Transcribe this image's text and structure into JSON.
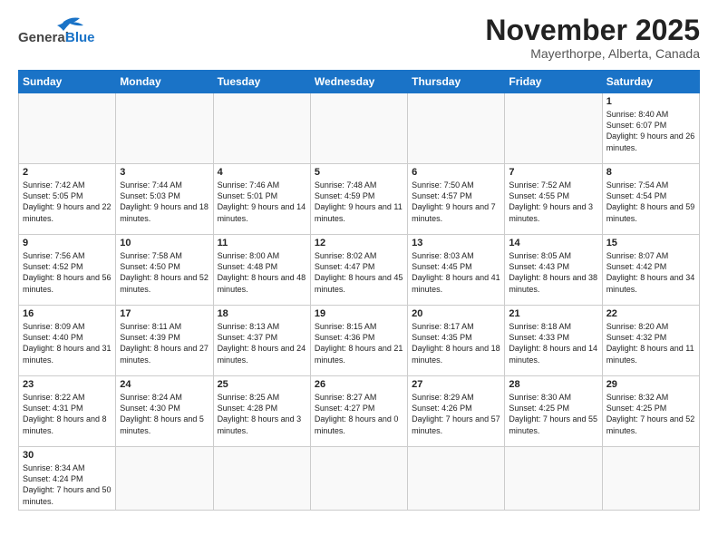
{
  "header": {
    "logo_general": "General",
    "logo_blue": "Blue",
    "month_title": "November 2025",
    "location": "Mayerthorpe, Alberta, Canada"
  },
  "days_of_week": [
    "Sunday",
    "Monday",
    "Tuesday",
    "Wednesday",
    "Thursday",
    "Friday",
    "Saturday"
  ],
  "weeks": [
    [
      {
        "day": "",
        "content": ""
      },
      {
        "day": "",
        "content": ""
      },
      {
        "day": "",
        "content": ""
      },
      {
        "day": "",
        "content": ""
      },
      {
        "day": "",
        "content": ""
      },
      {
        "day": "",
        "content": ""
      },
      {
        "day": "1",
        "content": "Sunrise: 8:40 AM\nSunset: 6:07 PM\nDaylight: 9 hours\nand 26 minutes."
      }
    ],
    [
      {
        "day": "2",
        "content": "Sunrise: 7:42 AM\nSunset: 5:05 PM\nDaylight: 9 hours\nand 22 minutes."
      },
      {
        "day": "3",
        "content": "Sunrise: 7:44 AM\nSunset: 5:03 PM\nDaylight: 9 hours\nand 18 minutes."
      },
      {
        "day": "4",
        "content": "Sunrise: 7:46 AM\nSunset: 5:01 PM\nDaylight: 9 hours\nand 14 minutes."
      },
      {
        "day": "5",
        "content": "Sunrise: 7:48 AM\nSunset: 4:59 PM\nDaylight: 9 hours\nand 11 minutes."
      },
      {
        "day": "6",
        "content": "Sunrise: 7:50 AM\nSunset: 4:57 PM\nDaylight: 9 hours\nand 7 minutes."
      },
      {
        "day": "7",
        "content": "Sunrise: 7:52 AM\nSunset: 4:55 PM\nDaylight: 9 hours\nand 3 minutes."
      },
      {
        "day": "8",
        "content": "Sunrise: 7:54 AM\nSunset: 4:54 PM\nDaylight: 8 hours\nand 59 minutes."
      }
    ],
    [
      {
        "day": "9",
        "content": "Sunrise: 7:56 AM\nSunset: 4:52 PM\nDaylight: 8 hours\nand 56 minutes."
      },
      {
        "day": "10",
        "content": "Sunrise: 7:58 AM\nSunset: 4:50 PM\nDaylight: 8 hours\nand 52 minutes."
      },
      {
        "day": "11",
        "content": "Sunrise: 8:00 AM\nSunset: 4:48 PM\nDaylight: 8 hours\nand 48 minutes."
      },
      {
        "day": "12",
        "content": "Sunrise: 8:02 AM\nSunset: 4:47 PM\nDaylight: 8 hours\nand 45 minutes."
      },
      {
        "day": "13",
        "content": "Sunrise: 8:03 AM\nSunset: 4:45 PM\nDaylight: 8 hours\nand 41 minutes."
      },
      {
        "day": "14",
        "content": "Sunrise: 8:05 AM\nSunset: 4:43 PM\nDaylight: 8 hours\nand 38 minutes."
      },
      {
        "day": "15",
        "content": "Sunrise: 8:07 AM\nSunset: 4:42 PM\nDaylight: 8 hours\nand 34 minutes."
      }
    ],
    [
      {
        "day": "16",
        "content": "Sunrise: 8:09 AM\nSunset: 4:40 PM\nDaylight: 8 hours\nand 31 minutes."
      },
      {
        "day": "17",
        "content": "Sunrise: 8:11 AM\nSunset: 4:39 PM\nDaylight: 8 hours\nand 27 minutes."
      },
      {
        "day": "18",
        "content": "Sunrise: 8:13 AM\nSunset: 4:37 PM\nDaylight: 8 hours\nand 24 minutes."
      },
      {
        "day": "19",
        "content": "Sunrise: 8:15 AM\nSunset: 4:36 PM\nDaylight: 8 hours\nand 21 minutes."
      },
      {
        "day": "20",
        "content": "Sunrise: 8:17 AM\nSunset: 4:35 PM\nDaylight: 8 hours\nand 18 minutes."
      },
      {
        "day": "21",
        "content": "Sunrise: 8:18 AM\nSunset: 4:33 PM\nDaylight: 8 hours\nand 14 minutes."
      },
      {
        "day": "22",
        "content": "Sunrise: 8:20 AM\nSunset: 4:32 PM\nDaylight: 8 hours\nand 11 minutes."
      }
    ],
    [
      {
        "day": "23",
        "content": "Sunrise: 8:22 AM\nSunset: 4:31 PM\nDaylight: 8 hours\nand 8 minutes."
      },
      {
        "day": "24",
        "content": "Sunrise: 8:24 AM\nSunset: 4:30 PM\nDaylight: 8 hours\nand 5 minutes."
      },
      {
        "day": "25",
        "content": "Sunrise: 8:25 AM\nSunset: 4:28 PM\nDaylight: 8 hours\nand 3 minutes."
      },
      {
        "day": "26",
        "content": "Sunrise: 8:27 AM\nSunset: 4:27 PM\nDaylight: 8 hours\nand 0 minutes."
      },
      {
        "day": "27",
        "content": "Sunrise: 8:29 AM\nSunset: 4:26 PM\nDaylight: 7 hours\nand 57 minutes."
      },
      {
        "day": "28",
        "content": "Sunrise: 8:30 AM\nSunset: 4:25 PM\nDaylight: 7 hours\nand 55 minutes."
      },
      {
        "day": "29",
        "content": "Sunrise: 8:32 AM\nSunset: 4:25 PM\nDaylight: 7 hours\nand 52 minutes."
      }
    ],
    [
      {
        "day": "30",
        "content": "Sunrise: 8:34 AM\nSunset: 4:24 PM\nDaylight: 7 hours\nand 50 minutes."
      },
      {
        "day": "",
        "content": ""
      },
      {
        "day": "",
        "content": ""
      },
      {
        "day": "",
        "content": ""
      },
      {
        "day": "",
        "content": ""
      },
      {
        "day": "",
        "content": ""
      },
      {
        "day": "",
        "content": ""
      }
    ]
  ]
}
